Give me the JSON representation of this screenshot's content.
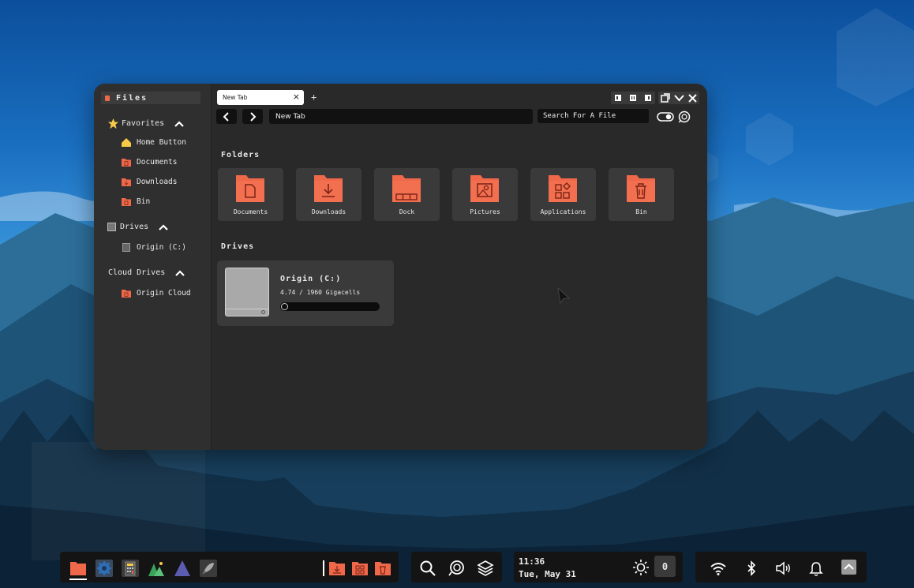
{
  "window": {
    "sidebar_title": "Files",
    "tab_label": "New Tab",
    "tab_close": "×",
    "new_tab": "+",
    "path": "New Tab",
    "search_placeholder": "Search For A File"
  },
  "sidebar": {
    "favorites_label": "Favorites",
    "favorites": [
      {
        "label": "Home Button",
        "icon": "home-icon"
      },
      {
        "label": "Documents",
        "icon": "folder-icon"
      },
      {
        "label": "Downloads",
        "icon": "folder-icon"
      },
      {
        "label": "Bin",
        "icon": "folder-icon"
      }
    ],
    "drives_label": "Drives",
    "drives": [
      {
        "label": "Origin (C:)",
        "icon": "drive-icon"
      }
    ],
    "cloud_label": "Cloud Drives",
    "cloud": [
      {
        "label": "Origin Cloud",
        "icon": "cloud-folder-icon"
      }
    ]
  },
  "main": {
    "folders_heading": "Folders",
    "folders": [
      {
        "label": "Documents",
        "icon": "document-folder-icon"
      },
      {
        "label": "Downloads",
        "icon": "download-folder-icon"
      },
      {
        "label": "Dock",
        "icon": "dock-folder-icon"
      },
      {
        "label": "Pictures",
        "icon": "picture-folder-icon"
      },
      {
        "label": "Applications",
        "icon": "apps-folder-icon"
      },
      {
        "label": "Bin",
        "icon": "bin-folder-icon"
      }
    ],
    "drives_heading": "Drives",
    "drive": {
      "name": "Origin (C:)",
      "capacity": "4.74 / 1960 Gigacells",
      "usage_fraction": 0.0024
    }
  },
  "taskbar": {
    "apps": [
      "files-icon",
      "settings-icon",
      "calculator-icon",
      "gallery-icon",
      "mountain-icon",
      "launcher-icon"
    ],
    "pinned": [
      "download-folder-icon",
      "apps-folder-icon",
      "bin-folder-icon"
    ],
    "tools": [
      "search-icon",
      "assistant-icon",
      "layers-icon"
    ],
    "time": "11:36",
    "date": "Tue, May 31",
    "brightness_icon": "sun-icon",
    "notification_count": "0",
    "tray": [
      "wifi-icon",
      "bluetooth-icon",
      "volume-icon",
      "bell-icon",
      "chevron-up-icon"
    ]
  },
  "colors": {
    "accent": "#f0684a",
    "window_bg": "#292929",
    "sidebar_bg": "#2f2f2f",
    "card_bg": "#3a3a3a"
  }
}
